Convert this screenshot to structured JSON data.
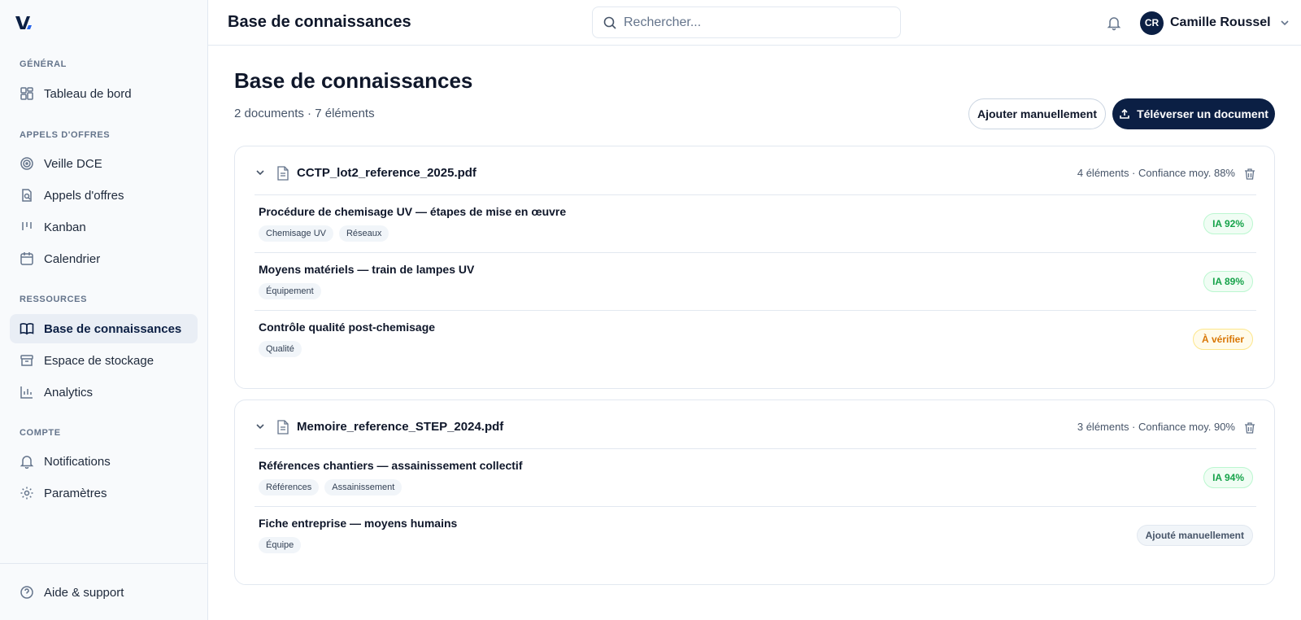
{
  "header": {
    "title": "Base de connaissances",
    "search_placeholder": "Rechercher...",
    "user": {
      "initials": "CR",
      "name": "Camille Roussel"
    }
  },
  "sidebar": {
    "sections": [
      {
        "label": "GÉNÉRAL"
      },
      {
        "label": "APPELS D'OFFRES"
      },
      {
        "label": "RESSOURCES"
      },
      {
        "label": "COMPTE"
      }
    ],
    "items": [
      {
        "label": "Tableau de bord",
        "icon": "dashboard-icon"
      },
      {
        "label": "Veille DCE",
        "icon": "target-icon"
      },
      {
        "label": "Appels d'offres",
        "icon": "document-search-icon"
      },
      {
        "label": "Kanban",
        "icon": "kanban-icon"
      },
      {
        "label": "Calendrier",
        "icon": "calendar-icon"
      },
      {
        "label": "Base de connaissances",
        "icon": "book-icon",
        "active": true
      },
      {
        "label": "Espace de stockage",
        "icon": "archive-icon"
      },
      {
        "label": "Analytics",
        "icon": "bar-chart-icon"
      },
      {
        "label": "Notifications",
        "icon": "bell-icon"
      },
      {
        "label": "Paramètres",
        "icon": "gear-icon"
      }
    ],
    "footer": {
      "label": "Aide & support",
      "icon": "help-circle-icon"
    }
  },
  "main": {
    "title": "Base de connaissances",
    "subtitle": "2 documents · 7 éléments",
    "add_manual_label": "Ajouter manuellement",
    "upload_label": "Téléverser un document",
    "documents": [
      {
        "name": "CCTP_lot2_reference_2025.pdf",
        "meta": "4 éléments · Confiance moy. 88%",
        "items": [
          {
            "title": "Procédure de chemisage UV — étapes de mise en œuvre",
            "tags": [
              "Chemisage UV",
              "Réseaux"
            ],
            "badge": "IA 92%",
            "badge_type": "ok"
          },
          {
            "title": "Moyens matériels — train de lampes UV",
            "tags": [
              "Équipement"
            ],
            "badge": "IA 89%",
            "badge_type": "ok"
          },
          {
            "title": "Contrôle qualité post-chemisage",
            "tags": [
              "Qualité"
            ],
            "badge": "À vérifier",
            "badge_type": "warn"
          }
        ]
      },
      {
        "name": "Memoire_reference_STEP_2024.pdf",
        "meta": "3 éléments · Confiance moy. 90%",
        "items": [
          {
            "title": "Références chantiers — assainissement collectif",
            "tags": [
              "Références",
              "Assainissement"
            ],
            "badge": "IA 94%",
            "badge_type": "ok"
          },
          {
            "title": "Fiche entreprise — moyens humains",
            "tags": [
              "Équipe"
            ],
            "badge": "Ajouté manuellement",
            "badge_type": "manual"
          }
        ]
      }
    ]
  },
  "colors": {
    "brand_navy": "#0b1f44",
    "ok_green": "#16a34a",
    "warn_amber": "#d97706"
  }
}
